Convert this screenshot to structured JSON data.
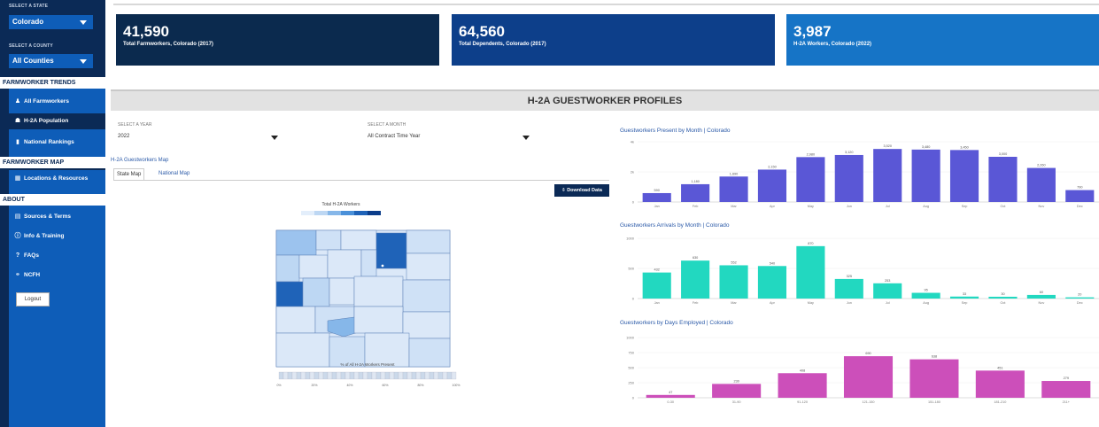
{
  "sidebar": {
    "state_label": "SELECT A STATE",
    "state_value": "Colorado",
    "county_label": "SELECT A COUNTY",
    "county_value": "All Counties",
    "sections": [
      {
        "title": "FARMWORKER TRENDS"
      },
      {
        "title": "FARMWORKER MAP"
      },
      {
        "title": "ABOUT"
      }
    ],
    "items": [
      {
        "label": "All Farmworkers",
        "icon": "users-icon"
      },
      {
        "label": "H-2A Population",
        "icon": "user-group-icon"
      },
      {
        "label": "National Rankings",
        "icon": "ranking-icon"
      },
      {
        "label": "Locations & Resources",
        "icon": "map-icon"
      },
      {
        "label": "Sources & Terms",
        "icon": "book-icon"
      },
      {
        "label": "Info & Training",
        "icon": "info-icon"
      },
      {
        "label": "FAQs",
        "icon": "question-icon"
      },
      {
        "label": "NCFH",
        "icon": "link-icon"
      }
    ],
    "logout_label": "Logout",
    "colors": {
      "dark": "#0b2a56",
      "blue": "#0e5db8"
    }
  },
  "cards": [
    {
      "number": "41,590",
      "label": "Total Farmworkers, Colorado (2017)",
      "color": "#0b2a4e"
    },
    {
      "number": "64,560",
      "label": "Total Dependents, Colorado (2017)",
      "color": "#0d3f8a"
    },
    {
      "number": "3,987",
      "label": "H-2A Workers, Colorado (2022)",
      "color": "#1674c6"
    }
  ],
  "profiles": {
    "title": "H-2A GUESTWORKER PROFILES",
    "year_label": "SELECT A YEAR",
    "year_value": "2022",
    "month_label": "SELECT A MONTH",
    "month_value": "All Contract Time Year",
    "map_link": "H-2A Guestworkers Map",
    "tabs": [
      "State Map",
      "National Map"
    ],
    "download_label": "Download Data"
  },
  "map": {
    "legend_title": "Total H-2A Workers",
    "bottom_legend_title": "% of All H-2A Workers Present",
    "legend_colors": [
      "#e3eefb",
      "#bdd7f3",
      "#86b7e9",
      "#4a90d9",
      "#1f63b8",
      "#0b3d8a"
    ],
    "bottom_ticks": [
      "0%",
      "20%",
      "40%",
      "60%",
      "80%",
      "100%"
    ]
  },
  "chart_data": [
    {
      "type": "bar",
      "title": "Guestworkers Present by Month | Colorado",
      "color": "#5a57d6",
      "categories": [
        "Jan",
        "Feb",
        "Mar",
        "Apr",
        "May",
        "Jun",
        "Jul",
        "Aug",
        "Sep",
        "Oct",
        "Nov",
        "Dec"
      ],
      "values": [
        590,
        1180,
        1690,
        2150,
        2980,
        3120,
        3520,
        3480,
        3450,
        3000,
        2260,
        790
      ],
      "ylim": [
        0,
        4000
      ],
      "yticks": [
        "0",
        "2k",
        "4k"
      ]
    },
    {
      "type": "bar",
      "title": "Guestworkers Arrivals by Month | Colorado",
      "color": "#22d8c0",
      "categories": [
        "Jan",
        "Feb",
        "Mar",
        "Apr",
        "May",
        "Jun",
        "Jul",
        "Aug",
        "Sep",
        "Oct",
        "Nov",
        "Dec"
      ],
      "values": [
        432,
        630,
        552,
        540,
        870,
        325,
        253,
        95,
        33,
        30,
        60,
        20
      ],
      "ylim": [
        0,
        1000
      ],
      "yticks": [
        "0",
        "500",
        "1000"
      ]
    },
    {
      "type": "bar",
      "title": "Guestworkers by Days Employed | Colorado",
      "color": "#cc4fba",
      "categories": [
        "0-30",
        "31-90",
        "91-120",
        "121-150",
        "151-180",
        "181-210",
        "211+"
      ],
      "values": [
        47,
        230,
        408,
        690,
        638,
        451,
        279
      ],
      "ylim": [
        0,
        1000
      ],
      "yticks": [
        "0",
        "250",
        "500",
        "750",
        "1000"
      ]
    }
  ]
}
